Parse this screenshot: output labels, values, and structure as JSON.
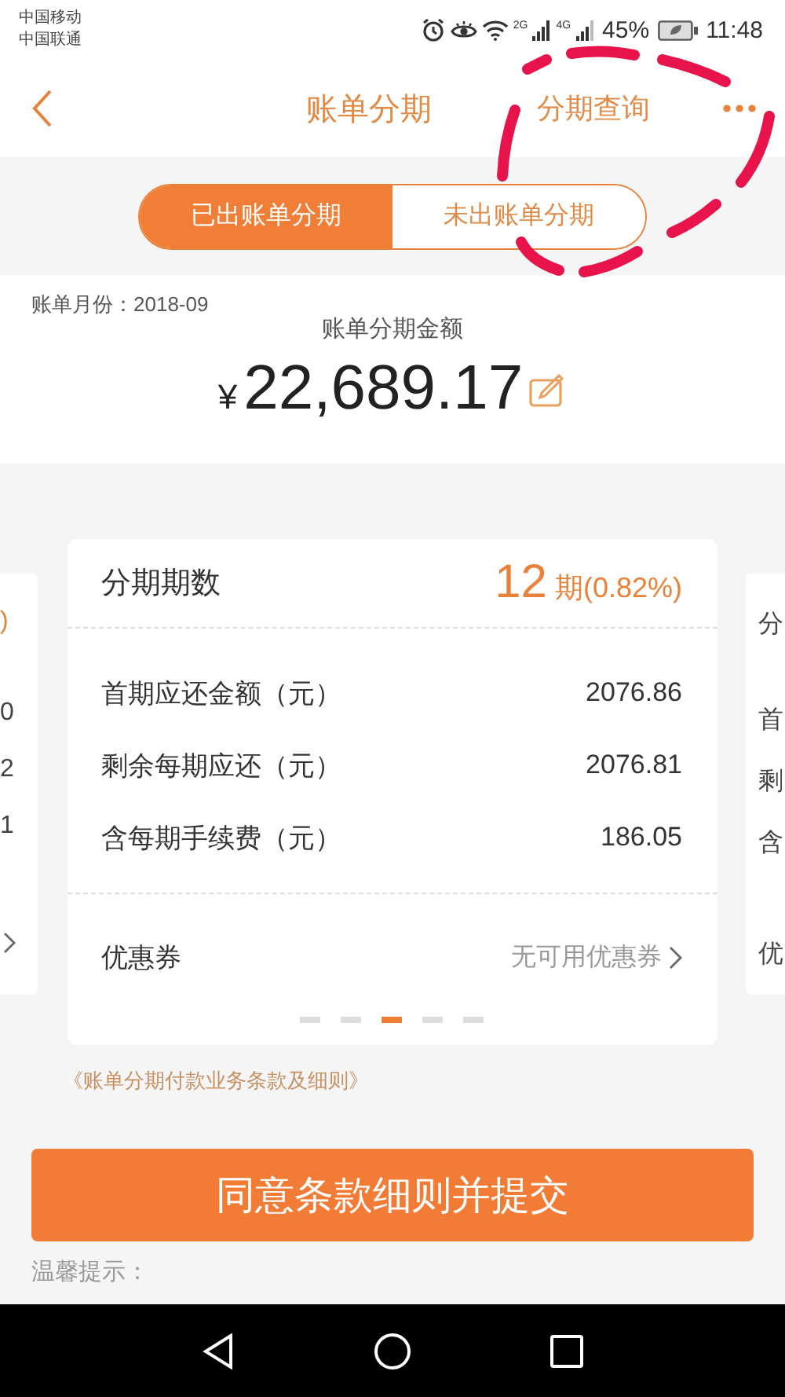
{
  "status_bar": {
    "carriers": [
      "中国移动",
      "中国联通"
    ],
    "network_labels": [
      "2G",
      "4G"
    ],
    "battery": "45%",
    "time": "11:48"
  },
  "nav": {
    "title": "账单分期",
    "action": "分期查询"
  },
  "tabs": [
    {
      "label": "已出账单分期",
      "selected": true
    },
    {
      "label": "未出账单分期",
      "selected": false
    }
  ],
  "bill": {
    "month_label": "账单月份：2018-09",
    "amount_label": "账单分期金额",
    "currency": "¥",
    "amount": "22,689.17"
  },
  "left_card": {
    "header": ")",
    "values": [
      "0",
      "2",
      "1"
    ]
  },
  "card": {
    "term_label": "分期期数",
    "term_count": "12",
    "term_unit": "期(0.82%)",
    "rows": [
      {
        "label": "首期应还金额（元）",
        "value": "2076.86"
      },
      {
        "label": "剩余每期应还（元）",
        "value": "2076.81"
      },
      {
        "label": "含每期手续费（元）",
        "value": "186.05"
      }
    ],
    "coupon_label": "优惠券",
    "coupon_value": "无可用优惠券",
    "pager": [
      {
        "selected": false
      },
      {
        "selected": false
      },
      {
        "selected": true
      },
      {
        "selected": false
      },
      {
        "selected": false
      }
    ]
  },
  "right_card": {
    "header": "分",
    "labels": [
      "首",
      "剩",
      "含"
    ],
    "coupon": "优"
  },
  "terms_link": "《账单分期付款业务条款及细则》",
  "submit_button": "同意条款细则并提交",
  "tip_label": "温馨提示：",
  "annotation": {
    "kind": "dashed_ellipse"
  }
}
